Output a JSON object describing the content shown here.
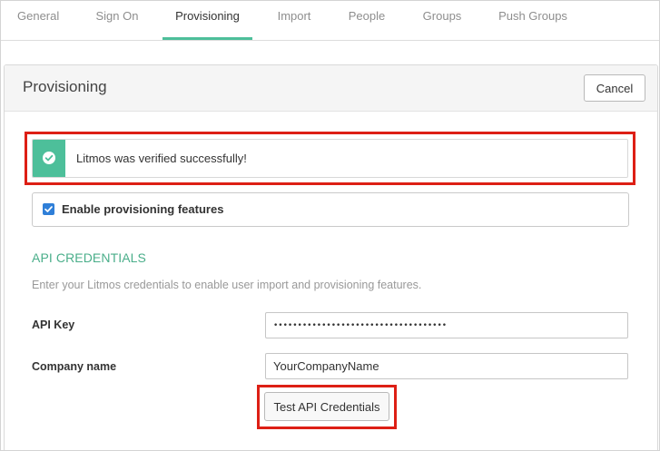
{
  "tabs": [
    {
      "label": "General"
    },
    {
      "label": "Sign On"
    },
    {
      "label": "Provisioning"
    },
    {
      "label": "Import"
    },
    {
      "label": "People"
    },
    {
      "label": "Groups"
    },
    {
      "label": "Push Groups"
    }
  ],
  "active_tab": "Provisioning",
  "panel": {
    "title": "Provisioning",
    "cancel_label": "Cancel"
  },
  "success": {
    "message": "Litmos was verified successfully!",
    "icon": "check-circle-icon"
  },
  "enable_provisioning": {
    "label": "Enable provisioning features",
    "checked": true
  },
  "api_credentials": {
    "title": "API CREDENTIALS",
    "description": "Enter your Litmos credentials to enable user import and provisioning features.",
    "api_key_label": "API Key",
    "api_key_value": "••••••••••••••••••••••••••••••••••••",
    "company_label": "Company name",
    "company_value": "YourCompanyName",
    "test_button_label": "Test API Credentials"
  },
  "colors": {
    "accent": "#4dbf9a",
    "section_title": "#4aae8a",
    "highlight": "#dd1f15",
    "checkbox": "#2f7fd8"
  }
}
